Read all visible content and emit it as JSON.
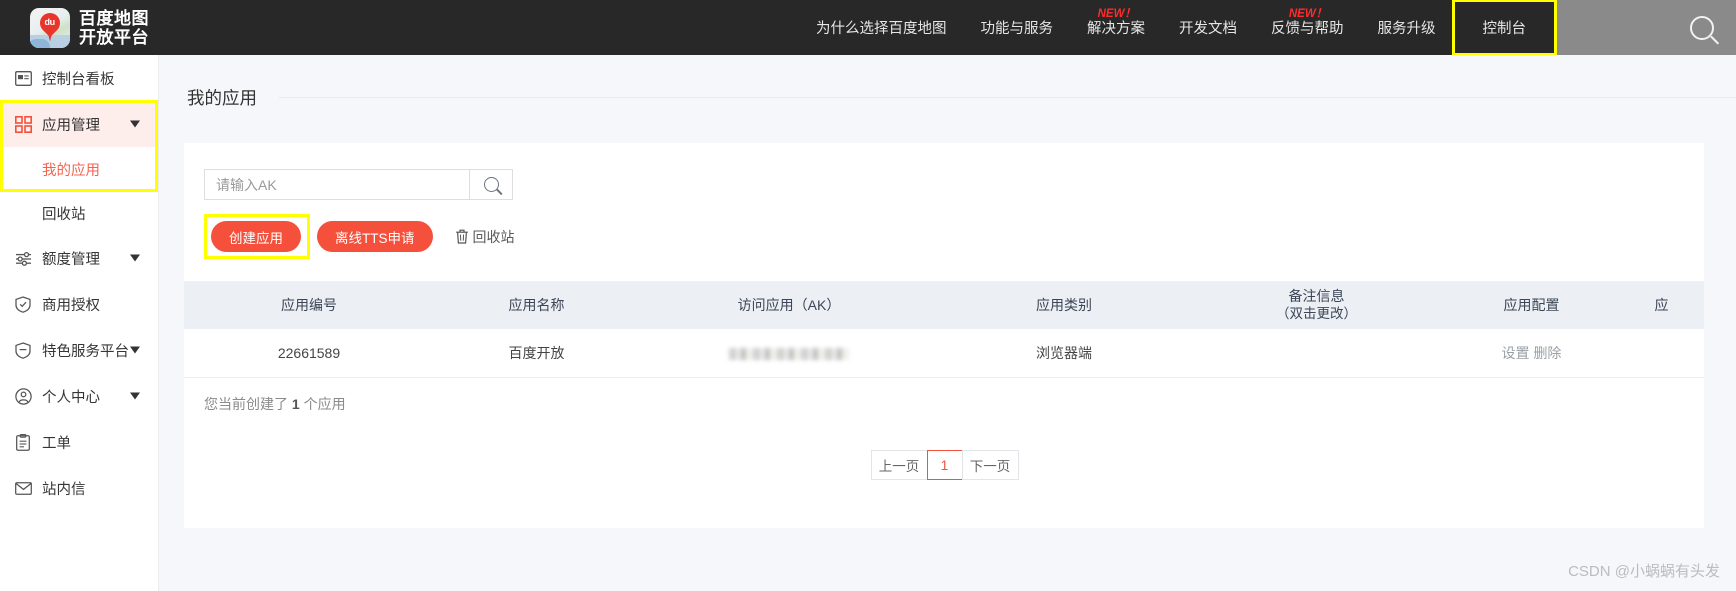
{
  "header": {
    "brand_line1": "百度地图",
    "brand_line2": "开放平台",
    "logo_text": "du",
    "nav": [
      {
        "label": "为什么选择百度地图",
        "badge": ""
      },
      {
        "label": "功能与服务",
        "badge": ""
      },
      {
        "label": "解决方案",
        "badge": "NEW！"
      },
      {
        "label": "开发文档",
        "badge": ""
      },
      {
        "label": "反馈与帮助",
        "badge": "NEW！"
      },
      {
        "label": "服务升级",
        "badge": ""
      },
      {
        "label": "控制台",
        "badge": ""
      }
    ],
    "search_icon": "search-icon"
  },
  "sidebar": {
    "items": [
      {
        "label": "控制台看板",
        "icon": "dashboard-icon",
        "caret": false
      },
      {
        "label": "应用管理",
        "icon": "apps-grid-icon",
        "caret": true
      },
      {
        "label": "额度管理",
        "icon": "sliders-icon",
        "caret": true
      },
      {
        "label": "商用授权",
        "icon": "shield-check-icon",
        "caret": false
      },
      {
        "label": "特色服务平台",
        "icon": "shield-minus-icon",
        "caret": true
      },
      {
        "label": "个人中心",
        "icon": "user-circle-icon",
        "caret": true
      },
      {
        "label": "工单",
        "icon": "clipboard-icon",
        "caret": false
      },
      {
        "label": "站内信",
        "icon": "envelope-icon",
        "caret": false
      }
    ],
    "sub_items": [
      {
        "label": "我的应用",
        "current": true
      },
      {
        "label": "回收站",
        "current": false
      }
    ]
  },
  "main": {
    "page_title": "我的应用",
    "search": {
      "placeholder": "请输入AK",
      "value": "",
      "button_icon": "search-icon"
    },
    "buttons": {
      "create": "创建应用",
      "tts": "离线TTS申请",
      "recycle": "回收站",
      "recycle_icon": "trash-icon"
    },
    "table": {
      "columns": [
        {
          "label": "应用编号",
          "sub": ""
        },
        {
          "label": "应用名称",
          "sub": ""
        },
        {
          "label": "访问应用（AK）",
          "sub": ""
        },
        {
          "label": "应用类别",
          "sub": ""
        },
        {
          "label": "备注信息",
          "sub": "（双击更改）"
        },
        {
          "label": "应用配置",
          "sub": ""
        },
        {
          "label": "应",
          "sub": ""
        }
      ],
      "rows": [
        {
          "id": "22661589",
          "name": "百度开放",
          "ak": "",
          "category": "浏览器端",
          "remark": "",
          "config_settings": "设置",
          "config_delete": "删除"
        }
      ]
    },
    "count_prefix": "您当前创建了 ",
    "count_value": "1",
    "count_suffix": " 个应用",
    "pagination": {
      "prev": "上一页",
      "current": "1",
      "next": "下一页"
    }
  },
  "watermark": "CSDN @小蜗蜗有头发",
  "colors": {
    "accent": "#f4503c",
    "topbar": "#282828",
    "highlight": "#ffff00",
    "active_bg": "#fdeeec",
    "page_bg": "#f5f7fa",
    "table_head": "#eceff4"
  }
}
